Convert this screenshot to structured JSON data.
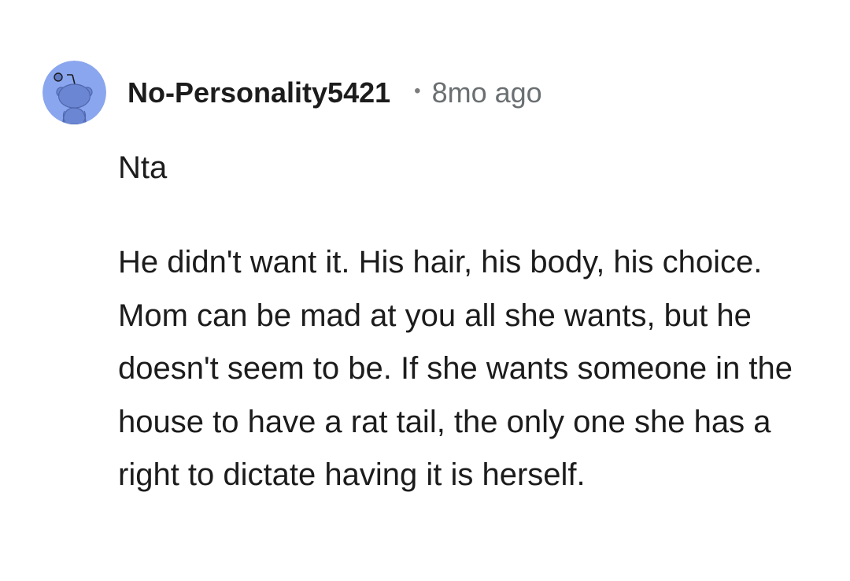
{
  "comment": {
    "avatar_icon": "reddit-snoo-avatar-icon",
    "avatar_color": "#8aa6ee",
    "username": "No-Personality5421",
    "separator": "•",
    "timestamp": "8mo ago",
    "body_line_1": "Nta",
    "body_paragraph": "He didn't want it. His hair, his body, his choice. Mom can be mad at you all she wants, but he doesn't seem to be. If she wants someone in the house to have a rat tail, the only one she has a right to dictate having it is herself."
  }
}
